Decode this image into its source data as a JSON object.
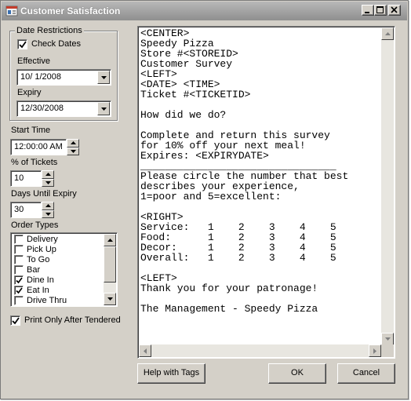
{
  "window": {
    "title": "Customer Satisfaction"
  },
  "date_restrictions": {
    "group_label": "Date Restrictions",
    "check_dates_label": "Check Dates",
    "check_dates_checked": true,
    "effective_label": "Effective",
    "effective_value": "10/  1/2008",
    "expiry_label": "Expiry",
    "expiry_value": "12/30/2008"
  },
  "start_time": {
    "label": "Start Time",
    "value": "12:00:00 AM"
  },
  "percent_tickets": {
    "label": "% of Tickets",
    "value": "10"
  },
  "days_until_expiry": {
    "label": "Days Until Expiry",
    "value": "30"
  },
  "order_types": {
    "label": "Order Types",
    "items": [
      {
        "label": "Delivery",
        "checked": false
      },
      {
        "label": "Pick Up",
        "checked": false
      },
      {
        "label": "To Go",
        "checked": false
      },
      {
        "label": "Bar",
        "checked": false
      },
      {
        "label": "Dine In",
        "checked": true
      },
      {
        "label": "Eat In",
        "checked": true
      },
      {
        "label": "Drive Thru",
        "checked": false
      }
    ]
  },
  "print_only_after_tendered": {
    "label": "Print Only After Tendered",
    "checked": true
  },
  "template_text": "<CENTER>\nSpeedy Pizza\nStore #<STOREID>\nCustomer Survey\n<LEFT>\n<DATE> <TIME>\nTicket #<TICKETID>\n\nHow did we do?\n\nComplete and return this survey\nfor 10% off your next meal!\nExpires: <EXPIRYDATE>\n________________________________\nPlease circle the number that best\ndescribes your experience,\n1=poor and 5=excellent:\n\n<RIGHT>\nService:   1    2    3    4    5\nFood:      1    2    3    4    5\nDecor:     1    2    3    4    5\nOverall:   1    2    3    4    5\n\n<LEFT>\nThank you for your patronage!\n\nThe Management - Speedy Pizza",
  "buttons": {
    "help": "Help with Tags",
    "ok": "OK",
    "cancel": "Cancel"
  }
}
